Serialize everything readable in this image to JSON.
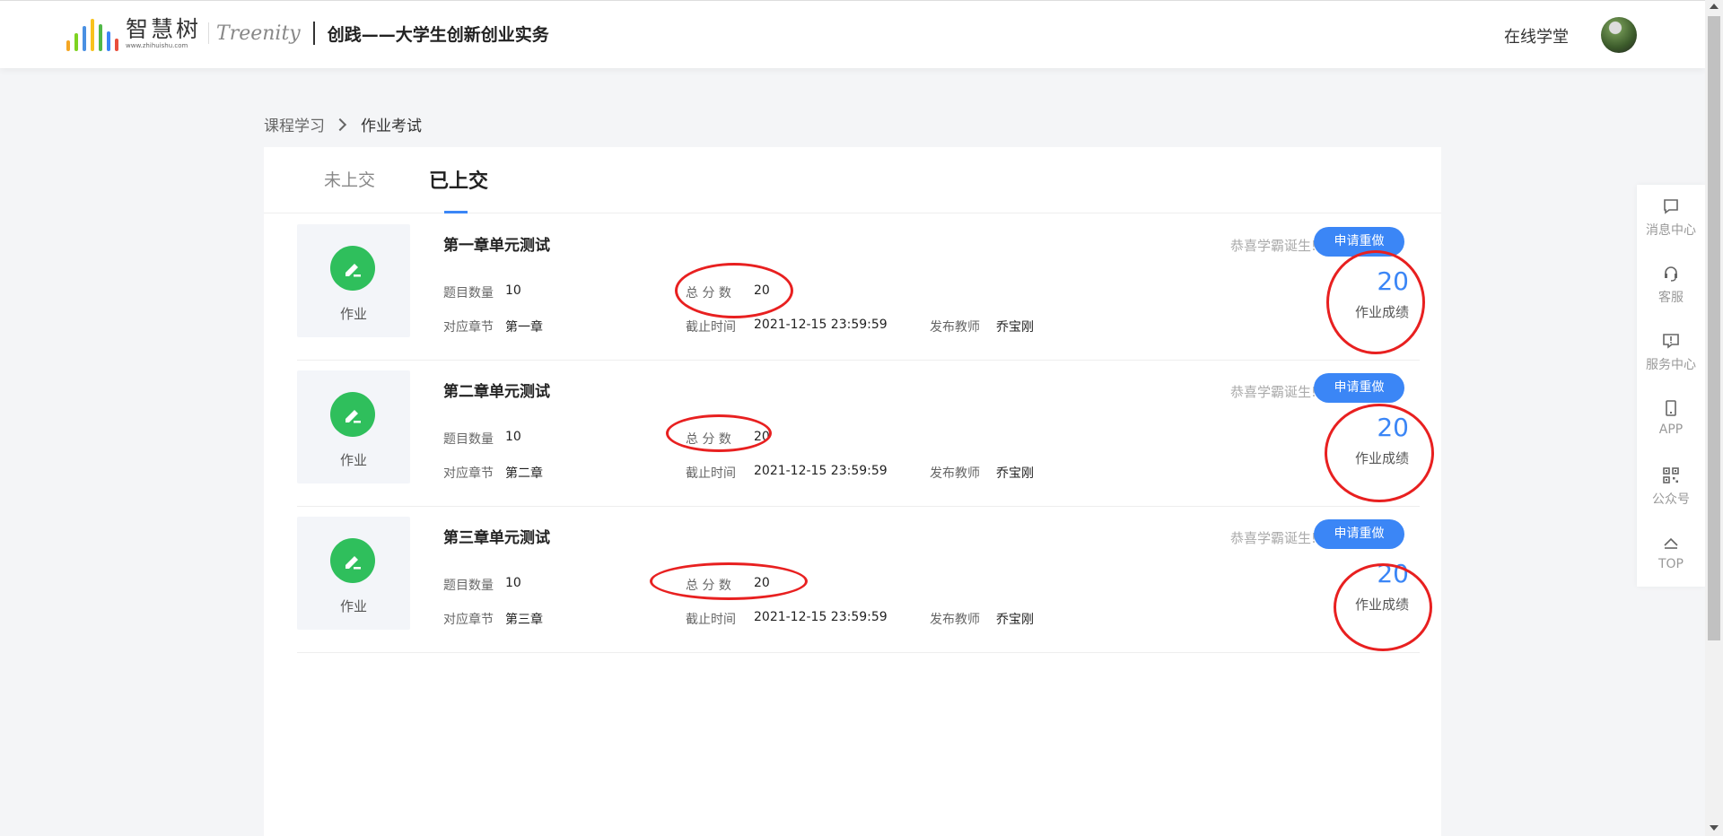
{
  "header": {
    "logo_cn": "智慧树",
    "logo_url": "www.zhihuishu.com",
    "logo_brand": "Treenity",
    "course_title": "创践——大学生创新创业实务",
    "online_label": "在线学堂"
  },
  "breadcrumb": {
    "link": "课程学习",
    "current": "作业考试"
  },
  "tabs": [
    {
      "label": "未上交",
      "active": false
    },
    {
      "label": "已上交",
      "active": true
    }
  ],
  "labels": {
    "thumb": "作业",
    "question_count": "题目数量",
    "total_score": "总 分 数",
    "chapter": "对应章节",
    "deadline": "截止时间",
    "teacher": "发布教师",
    "score_label": "作业成绩",
    "congrats": "恭喜学霸诞生!",
    "redo": "申请重做"
  },
  "assignments": [
    {
      "title": "第一章单元测试",
      "question_count": "10",
      "total_score": "20",
      "chapter": "第一章",
      "deadline": "2021-12-15 23:59:59",
      "teacher": "乔宝刚",
      "score": "20"
    },
    {
      "title": "第二章单元测试",
      "question_count": "10",
      "total_score": "20",
      "chapter": "第二章",
      "deadline": "2021-12-15 23:59:59",
      "teacher": "乔宝刚",
      "score": "20"
    },
    {
      "title": "第三章单元测试",
      "question_count": "10",
      "total_score": "20",
      "chapter": "第三章",
      "deadline": "2021-12-15 23:59:59",
      "teacher": "乔宝刚",
      "score": "20"
    }
  ],
  "float_bar": [
    {
      "label": "消息中心",
      "icon": "message-icon"
    },
    {
      "label": "客服",
      "icon": "headset-icon"
    },
    {
      "label": "服务中心",
      "icon": "service-alert-icon"
    },
    {
      "label": "APP",
      "icon": "phone-icon"
    },
    {
      "label": "公众号",
      "icon": "qr-code-icon"
    },
    {
      "label": "TOP",
      "icon": "arrow-up-icon"
    }
  ],
  "colors": {
    "accent": "#3b86f6",
    "thumb_green": "#2fbf5c",
    "annotation_red": "#e82020"
  }
}
